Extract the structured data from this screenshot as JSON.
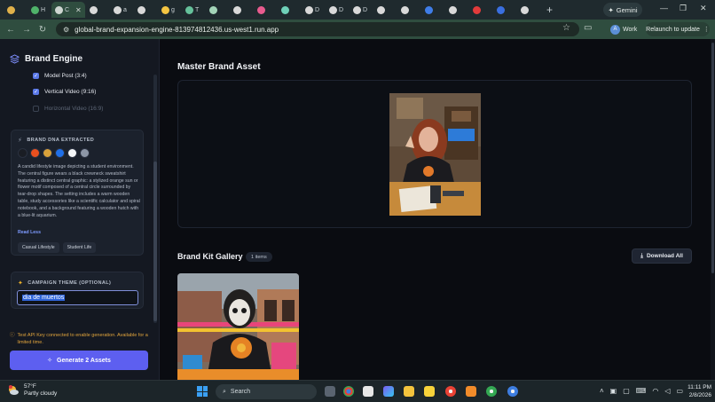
{
  "browser": {
    "tabs": [
      {
        "label": "",
        "color": "#e0b14a"
      },
      {
        "label": "H",
        "color": "#4fb36a"
      },
      {
        "label": "C",
        "color": "#cfd6d2",
        "active": true
      },
      {
        "label": "",
        "color": "#d9d9d9"
      },
      {
        "label": "a",
        "color": "#d9d9d9"
      },
      {
        "label": "",
        "color": "#d9d9d9"
      },
      {
        "label": "g",
        "color": "#f4c542"
      },
      {
        "label": "T",
        "color": "#66c19b"
      },
      {
        "label": "",
        "color": "#a3d4b8"
      },
      {
        "label": "",
        "color": "#d9d9d9"
      },
      {
        "label": "",
        "color": "#e85b8e"
      },
      {
        "label": "",
        "color": "#6fd0b8"
      },
      {
        "label": "D",
        "color": "#d9d9d9"
      },
      {
        "label": "D",
        "color": "#d9d9d9"
      },
      {
        "label": "D",
        "color": "#d9d9d9"
      },
      {
        "label": "",
        "color": "#d9d9d9"
      },
      {
        "label": "",
        "color": "#d9d9d9"
      },
      {
        "label": "",
        "color": "#3f7de8"
      },
      {
        "label": "",
        "color": "#d9d9d9"
      },
      {
        "label": "",
        "color": "#e33b3b"
      },
      {
        "label": "",
        "color": "#3a6fe0"
      },
      {
        "label": "",
        "color": "#d9d9d9"
      }
    ],
    "new_tab": "+",
    "gemini_label": "Gemini",
    "url": "global-brand-expansion-engine-813974812436.us-west1.run.app",
    "profile_initial": "A",
    "profile_label": "Work",
    "relaunch_label": "Relaunch to update",
    "minimize": "—",
    "restore": "❐",
    "close": "✕"
  },
  "sidebar": {
    "app_name": "Brand Engine",
    "formats": [
      {
        "label": "Model Post (3:4)",
        "checked": true
      },
      {
        "label": "Vertical Video (9:16)",
        "checked": true
      },
      {
        "label": "Horizontal Video (16:9)",
        "checked": false
      }
    ],
    "dna": {
      "title": "BRAND DNA EXTRACTED",
      "colors": [
        "#1a1d24",
        "#e9501f",
        "#d8a13a",
        "#1f6fe8",
        "#f4f6f8",
        "#8d96a6"
      ],
      "description": "A candid lifestyle image depicting a student environment. The central figure wears a black crewneck sweatshirt featuring a distinct central graphic: a stylized orange sun or flower motif composed of a central circle surrounded by tear-drop shapes. The setting includes a warm wooden table, study accessories like a scientific calculator and spiral notebook, and a background featuring a wooden hutch with a blue-lit aquarium.",
      "read_less": "Read Less",
      "tags": [
        "Casual Lifestyle",
        "Student Life"
      ]
    },
    "theme": {
      "title": "CAMPAIGN THEME (OPTIONAL)",
      "value": "dia de muertos"
    },
    "warning": "Test API Key connected to enable generation. Available for a limited time.",
    "generate_label": "Generate 2 Assets"
  },
  "main": {
    "master_title": "Master Brand Asset",
    "gallery_title": "Brand Kit Gallery",
    "gallery_count": "1 items",
    "download_label": "Download All"
  },
  "taskbar": {
    "temp": "57°F",
    "condition": "Partly cloudy",
    "search_placeholder": "Search",
    "time": "11:11 PM",
    "date": "2/8/2026"
  }
}
